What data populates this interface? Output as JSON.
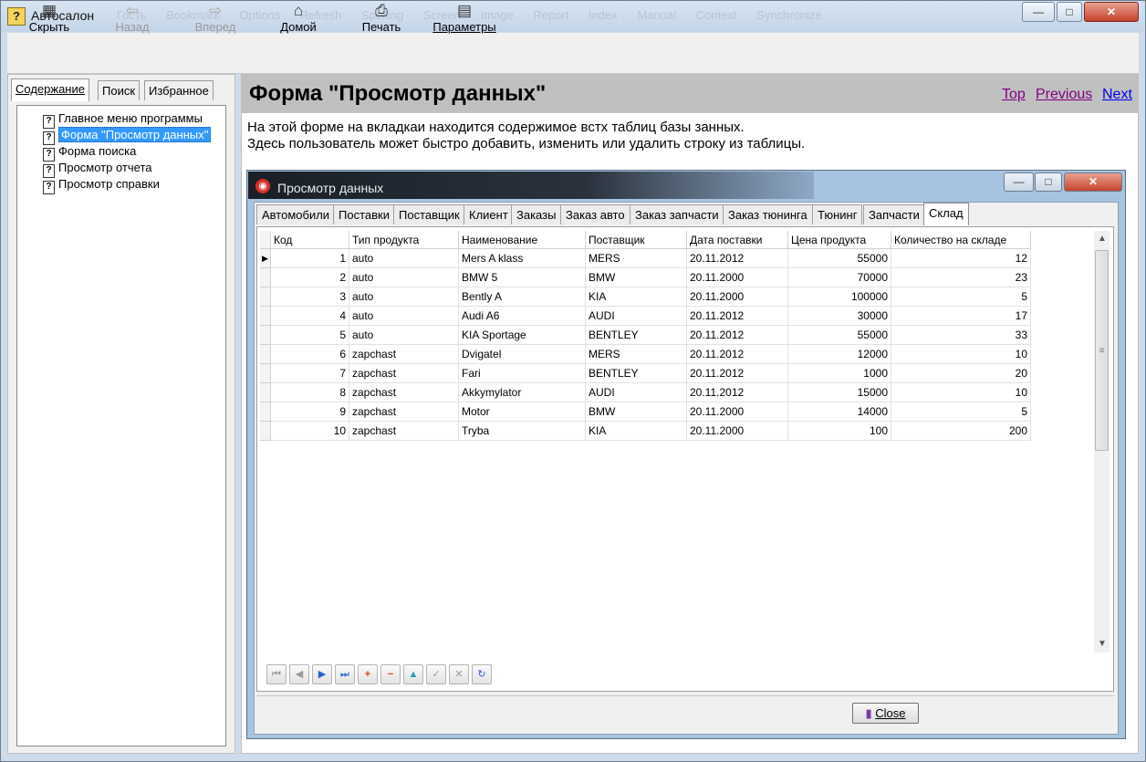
{
  "window": {
    "title": "Автосалон",
    "ghost_menu": "Гость Bookmark Options Refresh Spelling Screen Image Report Index Manual Context Synchronize",
    "controls": {
      "minimize": "—",
      "maximize": "□",
      "close": "✕"
    }
  },
  "toolbar": {
    "hide": {
      "label": "Скрыть",
      "icon": "hide-pane-icon"
    },
    "back": {
      "label": "Назад",
      "icon": "back-arrow-icon"
    },
    "forward": {
      "label": "Вперед",
      "icon": "forward-arrow-icon"
    },
    "home": {
      "label": "Домой",
      "icon": "home-icon"
    },
    "print": {
      "label": "Печать",
      "icon": "printer-icon"
    },
    "options": {
      "label": "Параметры",
      "icon": "options-icon"
    }
  },
  "left_tabs": [
    "Содержание",
    "Поиск",
    "Избранное"
  ],
  "tree": [
    {
      "label": "Главное меню программы",
      "selected": false
    },
    {
      "label": "Форма \"Просмотр данных\"",
      "selected": true
    },
    {
      "label": "Форма поиска",
      "selected": false
    },
    {
      "label": "Просмотр отчета",
      "selected": false
    },
    {
      "label": "Просмотр справки",
      "selected": false
    }
  ],
  "page": {
    "title": "Форма \"Просмотр данных\"",
    "nav": {
      "top": "Top",
      "previous": "Previous",
      "next": "Next"
    },
    "line1": "На этой форме на вкладкаи находится содержимое встх таблиц базы занных.",
    "line2": "Здесь пользователь может быстро добавить, изменить или удалить строку из таблицы."
  },
  "app": {
    "title": "Просмотр данных",
    "tabs": [
      "Автомобили",
      "Поставки",
      "Поставщик",
      "Клиент",
      "Заказы",
      "Заказ авто",
      "Заказ запчасти",
      "Заказ тюнинга",
      "Тюнинг",
      "Запчасти",
      "Склад"
    ],
    "active_tab": "Склад",
    "columns": [
      "Код",
      "Тип продукта",
      "Наименование",
      "Поставщик",
      "Дата поставки",
      "Цена продукта",
      "Количество на складе"
    ],
    "rows": [
      [
        "1",
        "auto",
        "Mers A klass",
        "MERS",
        "20.11.2012",
        "55000",
        "12"
      ],
      [
        "2",
        "auto",
        "BMW 5",
        "BMW",
        "20.11.2000",
        "70000",
        "23"
      ],
      [
        "3",
        "auto",
        "Bently A",
        "KIA",
        "20.11.2000",
        "100000",
        "5"
      ],
      [
        "4",
        "auto",
        "Audi A6",
        "AUDI",
        "20.11.2012",
        "30000",
        "17"
      ],
      [
        "5",
        "auto",
        "KIA Sportage",
        "BENTLEY",
        "20.11.2012",
        "55000",
        "33"
      ],
      [
        "6",
        "zapchast",
        "Dvigatel",
        "MERS",
        "20.11.2012",
        "12000",
        "10"
      ],
      [
        "7",
        "zapchast",
        "Fari",
        "BENTLEY",
        "20.11.2012",
        "1000",
        "20"
      ],
      [
        "8",
        "zapchast",
        "Akkymylator",
        "AUDI",
        "20.11.2012",
        "15000",
        "10"
      ],
      [
        "9",
        "zapchast",
        "Motor",
        "BMW",
        "20.11.2000",
        "14000",
        "5"
      ],
      [
        "10",
        "zapchast",
        "Tryba",
        "KIA",
        "20.11.2000",
        "100",
        "200"
      ]
    ],
    "navigator": [
      "first",
      "prior",
      "next",
      "last",
      "insert",
      "delete",
      "edit",
      "post",
      "cancel",
      "refresh"
    ],
    "close_label": "Close"
  },
  "colors": {
    "link": "#800080",
    "link_next": "#0000ee",
    "selected": "#3399ff",
    "header_bg": "#c0c0c0"
  }
}
